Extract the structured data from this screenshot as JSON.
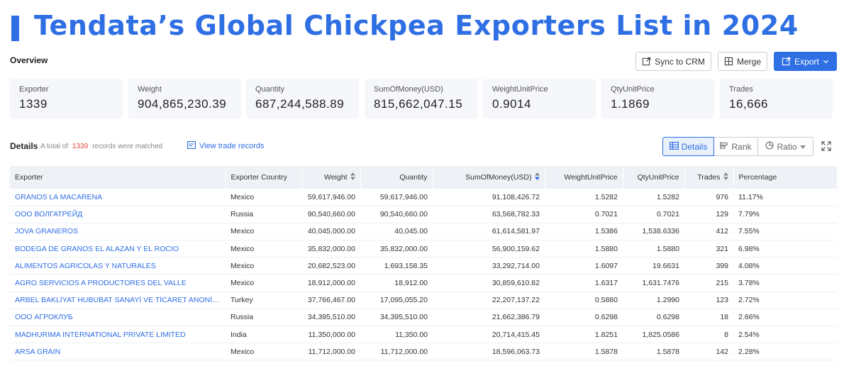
{
  "hero": {
    "title": "Tendata’s Global Chickpea Exporters List in 2024"
  },
  "overview": {
    "label": "Overview"
  },
  "toolbar": {
    "sync_label": "Sync to CRM",
    "merge_label": "Merge",
    "export_label": "Export"
  },
  "stats": [
    {
      "label": "Exporter",
      "value": "1339"
    },
    {
      "label": "Weight",
      "value": "904,865,230.39"
    },
    {
      "label": "Quantity",
      "value": "687,244,588.89"
    },
    {
      "label": "SumOfMoney(USD)",
      "value": "815,662,047.15"
    },
    {
      "label": "WeightUnitPrice",
      "value": "0.9014"
    },
    {
      "label": "QtyUnitPrice",
      "value": "1.1869"
    },
    {
      "label": "Trades",
      "value": "16,666"
    }
  ],
  "details": {
    "title": "Details",
    "meta_prefix": "A total of",
    "meta_count": "1339",
    "meta_suffix": "records were matched",
    "view_link": "View trade records",
    "views": {
      "details": "Details",
      "rank": "Rank",
      "ratio": "Ratio"
    }
  },
  "table": {
    "headers": [
      "Exporter",
      "Exporter Country",
      "Weight",
      "Quantity",
      "SumOfMoney(USD)",
      "WeightUnitPrice",
      "QtyUnitPrice",
      "Trades",
      "Percentage"
    ],
    "rows": [
      [
        "GRANOS LA MACARENA",
        "Mexico",
        "59,617,946.00",
        "59,617,946.00",
        "91,108,426.72",
        "1.5282",
        "1.5282",
        "976",
        "11.17%"
      ],
      [
        "ООО ВОЛГАТРЕЙД",
        "Russia",
        "90,540,660.00",
        "90,540,660.00",
        "63,568,782.33",
        "0.7021",
        "0.7021",
        "129",
        "7.79%"
      ],
      [
        "JOVA GRANEROS",
        "Mexico",
        "40,045,000.00",
        "40,045.00",
        "61,614,581.97",
        "1.5386",
        "1,538.6336",
        "412",
        "7.55%"
      ],
      [
        "BODEGA DE GRANOS EL ALAZAN Y EL ROCIO",
        "Mexico",
        "35,832,000.00",
        "35,832,000.00",
        "56,900,159.62",
        "1.5880",
        "1.5880",
        "321",
        "6.98%"
      ],
      [
        "ALIMENTOS AGRICOLAS Y NATURALES",
        "Mexico",
        "20,682,523.00",
        "1,693,158.35",
        "33,292,714.00",
        "1.6097",
        "19.6631",
        "399",
        "4.08%"
      ],
      [
        "AGRO SERVICIOS A PRODUCTORES DEL VALLE",
        "Mexico",
        "18,912,000.00",
        "18,912.00",
        "30,859,610.82",
        "1.6317",
        "1,631.7476",
        "215",
        "3.78%"
      ],
      [
        "ARBEL BAKLİYAT HUBUBAT SANAYİ VE TİCARET ANONİM ŞİRKETİ",
        "Turkey",
        "37,766,467.00",
        "17,095,055.20",
        "22,207,137.22",
        "0.5880",
        "1.2990",
        "123",
        "2.72%"
      ],
      [
        "ООО АГРОКЛУБ",
        "Russia",
        "34,395,510.00",
        "34,395,510.00",
        "21,662,386.79",
        "0.6298",
        "0.6298",
        "18",
        "2.66%"
      ],
      [
        "MADHURIMA INTERNATIONAL PRIVATE LIMITED",
        "India",
        "11,350,000.00",
        "11,350.00",
        "20,714,415.45",
        "1.8251",
        "1,825.0586",
        "8",
        "2.54%"
      ],
      [
        "ARSA GRAIN",
        "Mexico",
        "11,712,000.00",
        "11,712,000.00",
        "18,596,063.73",
        "1.5878",
        "1.5878",
        "142",
        "2.28%"
      ]
    ]
  }
}
